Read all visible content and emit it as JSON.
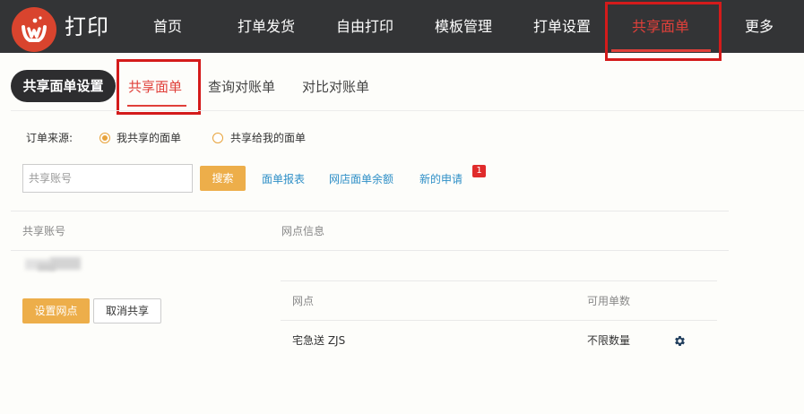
{
  "app": {
    "logo_text": "打印",
    "logo_icon": "logo-icon"
  },
  "nav": {
    "items": [
      {
        "label": "首页"
      },
      {
        "label": "打单发货"
      },
      {
        "label": "自由打印"
      },
      {
        "label": "模板管理"
      },
      {
        "label": "打单设置"
      },
      {
        "label": "共享面单",
        "active": true
      },
      {
        "label": "更多"
      }
    ]
  },
  "subnav": {
    "section_title": "共享面单设置",
    "tabs": [
      {
        "label": "共享面单",
        "active": true
      },
      {
        "label": "查询对账单"
      },
      {
        "label": "对比对账单"
      }
    ]
  },
  "filter": {
    "source_label": "订单来源:",
    "options": [
      {
        "label": "我共享的面单",
        "checked": true
      },
      {
        "label": "共享给我的面单",
        "checked": false
      }
    ]
  },
  "search": {
    "placeholder": "共享账号",
    "value": "",
    "button_label": "搜索",
    "links": [
      {
        "label": "面单报表"
      },
      {
        "label": "网店面单余额"
      },
      {
        "label": "新的申请"
      }
    ],
    "new_application_count": "1"
  },
  "table": {
    "headers": {
      "account": "共享账号",
      "site_info": "网点信息"
    },
    "row": {
      "actions": {
        "set_site": "设置网点",
        "cancel_share": "取消共享"
      },
      "sites": {
        "headers": {
          "site": "网点",
          "available": "可用单数"
        },
        "rows": [
          {
            "site": "宅急送 ZJS",
            "available": "不限数量",
            "action_icon": "gear-icon"
          }
        ]
      }
    }
  },
  "colors": {
    "nav_bg": "#333436",
    "accent_red": "#e0403a",
    "button_orange": "#edae4a",
    "link_blue": "#2e8fc7",
    "highlight_red": "#d41b1b"
  }
}
